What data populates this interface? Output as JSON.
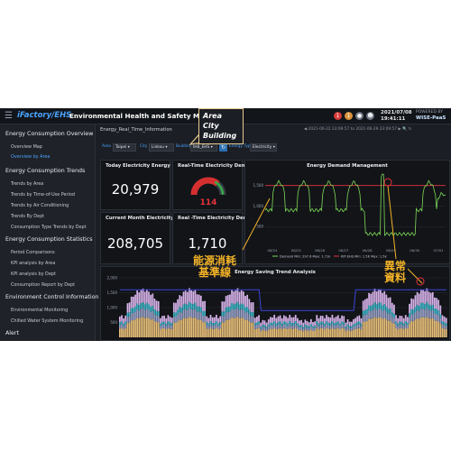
{
  "header": {
    "brand": "iFactory/EHS",
    "title": "Environmental Health and Safety Management",
    "date": "2021/07/08",
    "time": "19:41:11",
    "powered_by": "POWERED BY",
    "powered_brand": "WISE-PaaS",
    "notification_badges": [
      "1",
      "1"
    ]
  },
  "sidebar": {
    "sections": [
      {
        "label": "Energy Consumption Overview",
        "items": [
          {
            "label": "Overview Map",
            "active": false
          },
          {
            "label": "Overview by Area",
            "active": true
          }
        ]
      },
      {
        "label": "Energy Consumption Trends",
        "items": [
          {
            "label": "Trends by Area",
            "active": false
          },
          {
            "label": "Trends by Time-of-Use Period",
            "active": false
          },
          {
            "label": "Trends by Air Conditioning",
            "active": false
          },
          {
            "label": "Trends By Dept",
            "active": false
          },
          {
            "label": "Consumption Type Trends by Dept",
            "active": false
          }
        ]
      },
      {
        "label": "Energy Consumption Statistics",
        "items": [
          {
            "label": "Period Comparisons",
            "active": false
          },
          {
            "label": "KPI analysis by Area",
            "active": false
          },
          {
            "label": "KPI analysis by Dept",
            "active": false
          },
          {
            "label": "Consumption Report by Dept",
            "active": false
          }
        ]
      },
      {
        "label": "Environment Control Information",
        "items": [
          {
            "label": "Environmental Monitoring",
            "active": false
          },
          {
            "label": "Chilled Water System Monitoring",
            "active": false
          }
        ]
      },
      {
        "label": "Alert",
        "items": []
      }
    ]
  },
  "main": {
    "breadcrumb": "Energy_Real_Time_Information",
    "date_range": "2021-06-22 23:09:57 to 2021-06-29 23:09:57",
    "filters": [
      {
        "label": "Area",
        "value": "Taipei"
      },
      {
        "label": "City",
        "value": "Linkou"
      },
      {
        "label": "Building",
        "value": "IHB_EHS"
      },
      {
        "label": "Energy Type",
        "value": "Electricity"
      }
    ]
  },
  "kpis": {
    "today_title": "Today Electricity Energy",
    "today_value": "20,979",
    "rt_demand_title": "Real-Time Electricity Dem...",
    "gauge_value": "114",
    "gauge_fraction": 0.72,
    "month_title": "Current Month Electricity ...",
    "month_value": "208,705",
    "rt_title2": "Real -Time Electricity Dem...",
    "rt_value2": "1,710"
  },
  "chart_data": [
    {
      "type": "line",
      "title": "Energy Demand Management",
      "x": [
        "06/24",
        "06/25",
        "06/26",
        "06/27",
        "06/28",
        "06/29",
        "06/30",
        "07/01"
      ],
      "ylim": [
        0,
        1800
      ],
      "yticks": [
        "1,500",
        "1,000",
        "500"
      ],
      "baseline": 1500,
      "series": [
        {
          "name": "Demand",
          "legend": "Demand Min: 297.6  Max: 1.71k",
          "color": "#7ed957"
        },
        {
          "name": "KPI",
          "legend": "KPI EHS Min: 1.5K  Max: 1.5k",
          "color": "#e8323c"
        }
      ]
    },
    {
      "type": "bar",
      "title": "Energy Saving Trend Analysis",
      "ylim": [
        0,
        2000
      ],
      "yticks": [
        "2,000",
        "1,500",
        "1,000",
        "500"
      ],
      "series_colors": [
        "#e9c07a",
        "#9aa3c9",
        "#3fb7c9",
        "#d7b3ea"
      ],
      "baseline_color": "#3a46d6"
    }
  ],
  "annotations": {
    "callout": [
      "Area",
      "City",
      "Building"
    ],
    "baseline_label": [
      "能源消耗",
      "基準線"
    ],
    "anomaly_label": [
      "異常",
      "資料"
    ]
  }
}
